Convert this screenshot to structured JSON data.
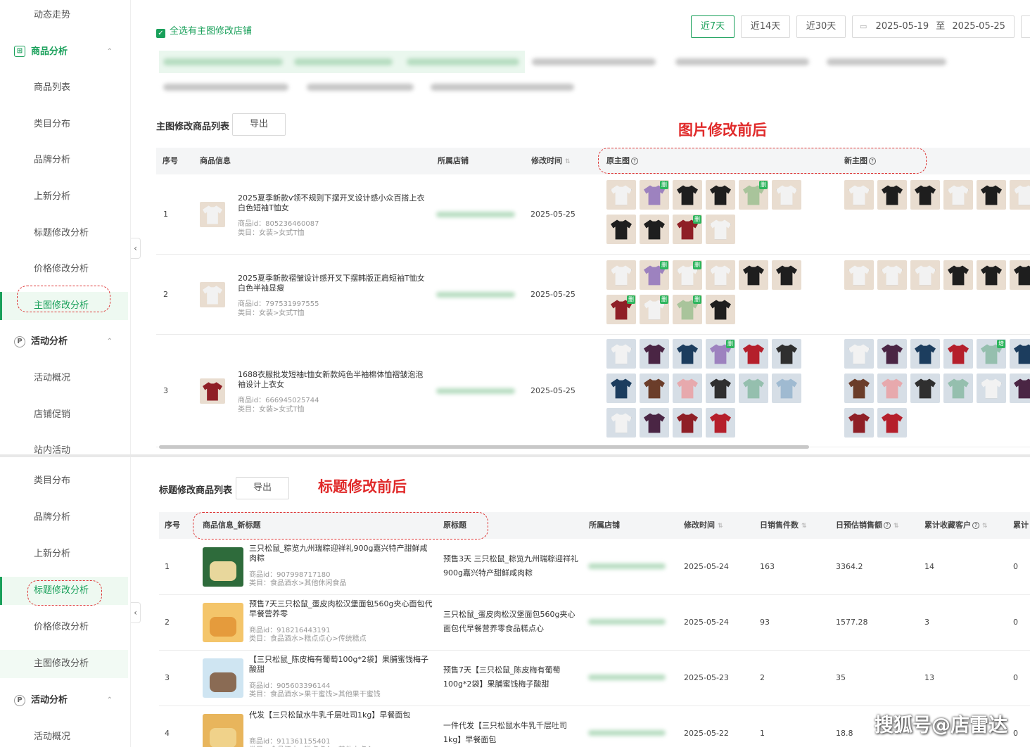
{
  "p1": {
    "sidebar": [
      {
        "label": "动态走势",
        "type": "sub"
      },
      {
        "label": "商品分析",
        "type": "group",
        "icon": "goods-icon",
        "expanded": true
      },
      {
        "label": "商品列表",
        "type": "sub"
      },
      {
        "label": "类目分布",
        "type": "sub"
      },
      {
        "label": "品牌分析",
        "type": "sub"
      },
      {
        "label": "上新分析",
        "type": "sub"
      },
      {
        "label": "标题修改分析",
        "type": "sub"
      },
      {
        "label": "价格修改分析",
        "type": "sub"
      },
      {
        "label": "主图修改分析",
        "type": "sub",
        "active": true
      },
      {
        "label": "活动分析",
        "type": "group",
        "icon": "promo-icon",
        "expanded": true
      },
      {
        "label": "活动概况",
        "type": "sub"
      },
      {
        "label": "店铺促销",
        "type": "sub"
      },
      {
        "label": "站内活动",
        "type": "sub"
      }
    ],
    "select_all_label": "全选有主图修改店铺",
    "date_buttons": [
      "近7天",
      "近14天",
      "近30天"
    ],
    "date_range": {
      "start": "2025-05-19",
      "sep": "至",
      "end": "2025-05-25"
    },
    "section_title": "主图修改商品列表",
    "export_label": "导出",
    "annotation": "图片修改前后",
    "columns": {
      "index": "序号",
      "info": "商品信息",
      "shop": "所属店铺",
      "time": "修改时间",
      "old_img": "原主图",
      "new_img": "新主图"
    },
    "rows": [
      {
        "index": "1",
        "title": "2025夏季新款v领不规则下摆开叉设计感小众百搭上衣白色短袖T恤女",
        "id": "商品id：805236460087",
        "cat": "类目：女装>女式T恤",
        "time": "2025-05-25"
      },
      {
        "index": "2",
        "title": "2025夏季新款褶皱设计感开叉下摆韩版正肩短袖T恤女白色半袖显瘦",
        "id": "商品id：797531997555",
        "cat": "类目：女装>女式T恤",
        "time": "2025-05-25"
      },
      {
        "index": "3",
        "title": "1688衣服批发短袖t恤女新款纯色半袖棉体恤褶皱泡泡袖设计上衣女",
        "id": "商品id：666945025744",
        "cat": "类目：女装>女式T恤",
        "time": "2025-05-25"
      }
    ],
    "badges": {
      "del": "删",
      "add": "增"
    }
  },
  "p2": {
    "sidebar": [
      {
        "label": "类目分布",
        "type": "sub"
      },
      {
        "label": "品牌分析",
        "type": "sub"
      },
      {
        "label": "上新分析",
        "type": "sub"
      },
      {
        "label": "标题修改分析",
        "type": "sub",
        "active": true
      },
      {
        "label": "价格修改分析",
        "type": "sub"
      },
      {
        "label": "主图修改分析",
        "type": "sub",
        "hover": true
      },
      {
        "label": "活动分析",
        "type": "group",
        "icon": "promo-icon",
        "expanded": true
      },
      {
        "label": "活动概况",
        "type": "sub"
      }
    ],
    "section_title": "标题修改商品列表",
    "export_label": "导出",
    "annotation": "标题修改前后",
    "columns": {
      "index": "序号",
      "info": "商品信息_新标题",
      "orig": "原标题",
      "shop": "所属店铺",
      "time": "修改时间",
      "daily_sales": "日销售件数",
      "daily_amount": "日预估销售额",
      "fav": "累计收藏客户",
      "more": "累计"
    },
    "rows": [
      {
        "index": "1",
        "title": "三只松鼠_粽览九州瑞粽迎祥礼900g嘉兴特产甜鲜咸肉粽",
        "id": "商品id：907998717180",
        "cat": "类目：食品酒水>其他休闲食品",
        "orig": "预售3天 三只松鼠_粽览九州瑞粽迎祥礼900g嘉兴特产甜鲜咸肉粽",
        "time": "2025-05-24",
        "sales": "163",
        "amount": "3364.2",
        "fav": "14",
        "more": "0"
      },
      {
        "index": "2",
        "title": "预售7天三只松鼠_蛋皮肉松汉堡面包560g夹心面包代早餐营养零",
        "id": "商品id：918216443191",
        "cat": "类目：食品酒水>糕点点心>传统糕点",
        "orig": "三只松鼠_蛋皮肉松汉堡面包560g夹心面包代早餐营养零食品糕点心",
        "time": "2025-05-24",
        "sales": "93",
        "amount": "1577.28",
        "fav": "3",
        "more": "0"
      },
      {
        "index": "3",
        "title": "【三只松鼠_陈皮梅有葡萄100g*2袋】果脯蜜饯梅子酸甜",
        "id": "商品id：905603396144",
        "cat": "类目：食品酒水>果干蜜饯>其他果干蜜饯",
        "orig": "预售7天【三只松鼠_陈皮梅有葡萄100g*2袋】果脯蜜饯梅子酸甜",
        "time": "2025-05-23",
        "sales": "2",
        "amount": "35",
        "fav": "13",
        "more": "0"
      },
      {
        "index": "4",
        "title": "代发【三只松鼠水牛乳千层吐司1kg】早餐面包",
        "id": "商品id：911361155401",
        "cat": "类目：食品酒水>糕点点心>其他小点心",
        "orig": "一件代发【三只松鼠水牛乳千层吐司1kg】早餐面包",
        "time": "2025-05-22",
        "sales": "1",
        "amount": "18.8",
        "fav": "",
        "more": "0"
      }
    ]
  },
  "watermark": "搜狐号@店雷达"
}
